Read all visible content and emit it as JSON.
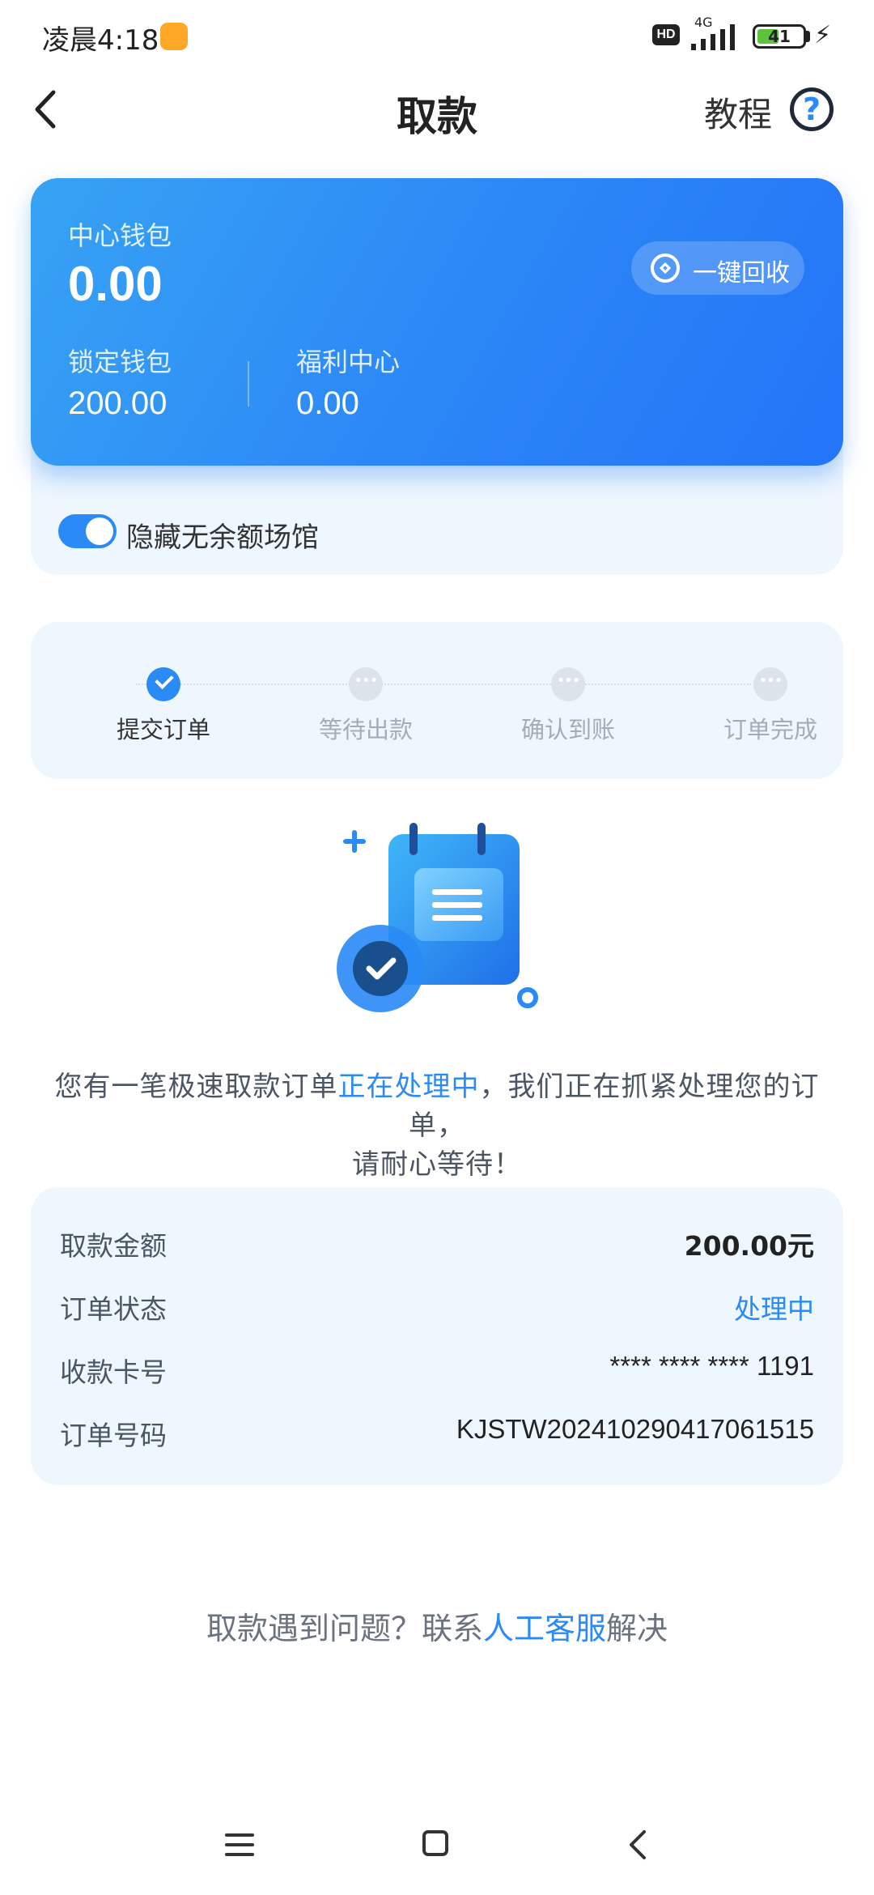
{
  "status_bar": {
    "time": "凌晨4:18",
    "hd": "HD",
    "network": "4G",
    "battery": "41"
  },
  "nav": {
    "title": "取款",
    "tutorial": "教程",
    "help_symbol": "?"
  },
  "wallet": {
    "center_label": "中心钱包",
    "center_value": "0.00",
    "recycle_button": "一键回收",
    "locked_label": "锁定钱包",
    "locked_value": "200.00",
    "welfare_label": "福利中心",
    "welfare_value": "0.00"
  },
  "toggle": {
    "label": "隐藏无余额场馆",
    "on": true
  },
  "steps": [
    {
      "label": "提交订单",
      "state": "done"
    },
    {
      "label": "等待出款",
      "state": "pending"
    },
    {
      "label": "确认到账",
      "state": "pending"
    },
    {
      "label": "订单完成",
      "state": "pending"
    }
  ],
  "message": {
    "part1": "您有一笔极速取款订单",
    "highlight": "正在处理中",
    "part2": "，我们正在抓紧处理您的订单，",
    "line2": "请耐心等待！"
  },
  "details": {
    "amount_label": "取款金额",
    "amount_value": "200.00元",
    "status_label": "订单状态",
    "status_value": "处理中",
    "card_label": "收款卡号",
    "card_value": "**** **** **** 1191",
    "order_label": "订单号码",
    "order_value": "KJSTW20241029041706​1515"
  },
  "help": {
    "prefix": "取款遇到问题？联系",
    "link": "人工客服",
    "suffix": "解决"
  },
  "colors": {
    "accent": "#2a8af6",
    "card_start": "#37a3f4",
    "card_end": "#2474f8",
    "panel_bg": "#eef6fe"
  },
  "icons": [
    "back-chevron-icon",
    "help-circle-icon",
    "recycle-icon",
    "calendar-check-icon",
    "menu-icon",
    "home-icon",
    "back-icon"
  ]
}
